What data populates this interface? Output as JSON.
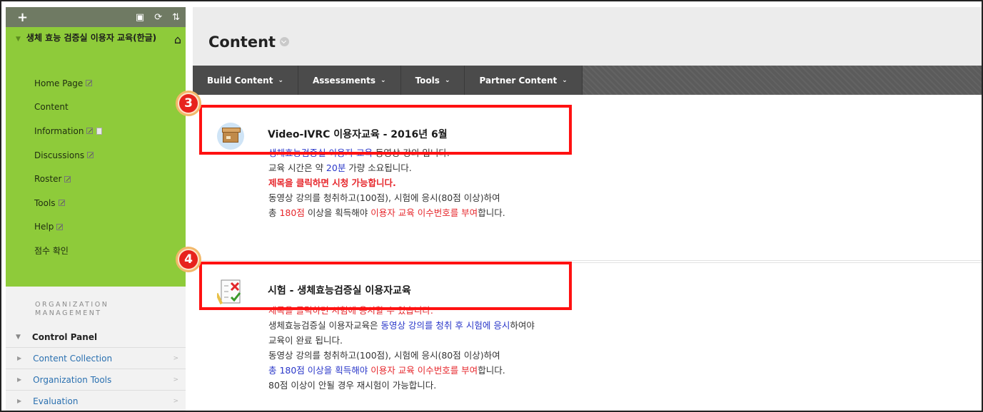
{
  "sidebar": {
    "toolbar": {
      "add_icon": "plus-icon",
      "icons": [
        "folder-view-icon",
        "refresh-icon",
        "sort-icon"
      ]
    },
    "course_title": "생체 효능 검증실 이용자 교육(한글)",
    "menu": [
      {
        "label": "Home Page",
        "edit": true,
        "page": false
      },
      {
        "label": "Content",
        "edit": false,
        "page": false
      },
      {
        "label": "Information",
        "edit": true,
        "page": true
      },
      {
        "label": "Discussions",
        "edit": true,
        "page": false
      },
      {
        "label": "Roster",
        "edit": true,
        "page": false
      },
      {
        "label": "Tools",
        "edit": true,
        "page": false
      },
      {
        "label": "Help",
        "edit": true,
        "page": false
      },
      {
        "label": "점수 확인",
        "edit": false,
        "page": false
      }
    ],
    "org_title": "ORGANIZATION MANAGEMENT",
    "control_panel": "Control Panel",
    "cp_items": [
      "Content Collection",
      "Organization Tools",
      "Evaluation"
    ]
  },
  "main": {
    "title": "Content",
    "actions": [
      "Build Content",
      "Assessments",
      "Tools",
      "Partner Content"
    ],
    "item1": {
      "title": "Video-IVRC 이용자교육 - 2016년 6월",
      "line1_a": "생체효능검증실 이용자 교육",
      "line1_b": " 동영상 강의 입니다.",
      "line2_a": "교육 시간은 약 ",
      "line2_b": "20분",
      "line2_c": " 가량 소요됩니다.",
      "line3": "제목을 클릭하면 시청 가능합니다.",
      "line4": "동영상 강의를 청취하고(100점), 시험에 응시(80점 이상)하여",
      "line5_a": "총 ",
      "line5_b": "180점",
      "line5_c": " 이상을 획득해야 ",
      "line5_d": "이용자 교육 이수번호를 부여",
      "line5_e": "합니다."
    },
    "item2": {
      "title": "시험 - 생체효능검증실 이용자교육",
      "line1": "제목을 클릭하면 시험에 응시할 수 있습니다.",
      "line2_a": "생체효능검증실 이용자교육은 ",
      "line2_b": "동영상 강의를 청취 후 시험에 응시",
      "line2_c": "하여야",
      "line3": "교육이 완료 됩니다.",
      "line4": "동영상 강의를 청취하고(100점), 시험에 응시(80점 이상)하여",
      "line5_a": "총 180점 이상을 획득해야 ",
      "line5_b": "이용자 교육 이수번호를 부여",
      "line5_c": "합니다.",
      "line6": "80점 이상이 안될 경우 재시험이 가능합니다."
    }
  },
  "annotations": {
    "badge1": "3",
    "badge2": "4",
    "color": "#ff1111"
  }
}
